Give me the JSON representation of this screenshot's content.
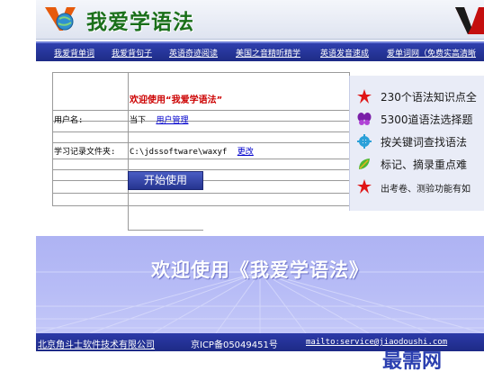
{
  "header": {
    "title": "我爱学语法",
    "logo_icon": "globe-v-logo-icon"
  },
  "nav": {
    "items": [
      "我爱背单词",
      "我爱背句子",
      "英语奇迹阅读",
      "美国之音精听精学",
      "英语发音速成",
      "爱单词网（免费实高清晰"
    ]
  },
  "form": {
    "heading": "欢迎使用“我爱学语法”",
    "username_label": "用户名:",
    "current_user_prefix": "当下",
    "user_manage_link": "用户管理",
    "folder_label": "学习记录文件夹:",
    "folder_path": "C:\\jdssoftware\\waxyf",
    "change_link": "更改",
    "start_button": "开始使用"
  },
  "features": [
    {
      "icon": "red-star-icon",
      "text": "230个语法知识点全"
    },
    {
      "icon": "purple-butterfly-icon",
      "text": "5300道语法选择题"
    },
    {
      "icon": "blue-gear-icon",
      "text": "按关键词查找语法"
    },
    {
      "icon": "green-leaf-icon",
      "text": "标记、摘录重点难"
    },
    {
      "icon": "red-star-icon",
      "text": "出考卷、测验功能有如"
    }
  ],
  "banner": {
    "text": "欢迎使用《我爱学语法》"
  },
  "footer": {
    "company": "北京角斗士软件技术有限公司",
    "icp": "京ICP备05049451号",
    "email": "mailto:service@jiaodoushi.com"
  },
  "watermark": "最需网",
  "colors": {
    "nav_bg": "#1e2c86",
    "title_green": "#1a6f1a",
    "heading_red": "#cc0000",
    "link_blue": "#0000cc",
    "banner_bg": "#b7bcf6"
  }
}
